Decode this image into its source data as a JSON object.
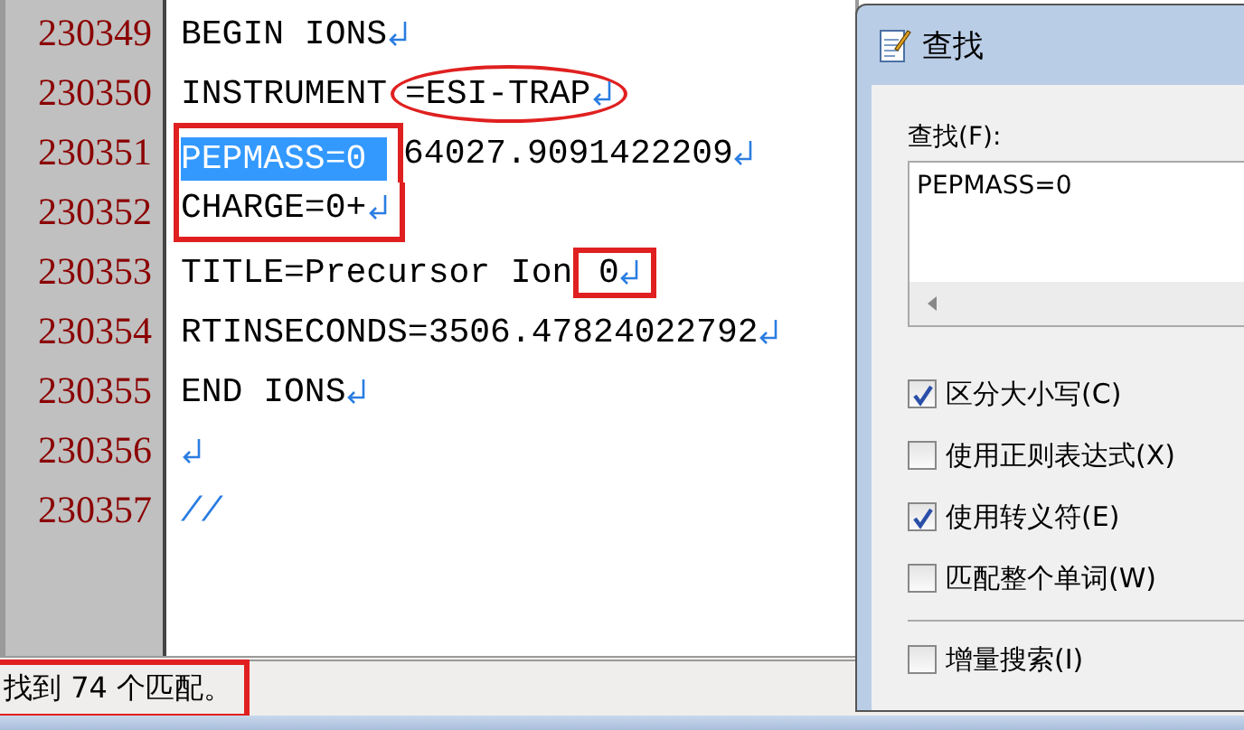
{
  "editor": {
    "lines": [
      {
        "number": "230349",
        "segments": [
          {
            "text": "BEGIN IONS"
          }
        ],
        "eol": true
      },
      {
        "number": "230350",
        "segments": [
          {
            "text": "INSTRUMENT"
          },
          {
            "text": "=ESI-TRAP",
            "circled": true,
            "eol": true
          }
        ]
      },
      {
        "number": "230351",
        "segments": [
          {
            "text": "PEPMASS=0 ",
            "selected": true,
            "boxed": true
          },
          {
            "text": "64027.9091422209"
          }
        ],
        "eol": true
      },
      {
        "number": "230352",
        "segments": [
          {
            "text": "CHARGE=0+",
            "boxed": true,
            "eol": true
          }
        ]
      },
      {
        "number": "230353",
        "segments": [
          {
            "text": "TITLE=Precursor Ion"
          },
          {
            "text": " 0",
            "boxed": true,
            "eol": true
          }
        ]
      },
      {
        "number": "230354",
        "segments": [
          {
            "text": "RTINSECONDS=3506.47824022792"
          }
        ],
        "eol": true
      },
      {
        "number": "230355",
        "segments": [
          {
            "text": "END IONS"
          }
        ],
        "eol": true
      },
      {
        "number": "230356",
        "eol": true
      },
      {
        "number": "230357",
        "segments": [
          {
            "text": "//",
            "kind": "eof"
          }
        ]
      }
    ]
  },
  "status_bar": {
    "text": "找到 74 个匹配。",
    "marked": true
  },
  "find_dialog": {
    "title": "查找",
    "find_label": "查找(F):",
    "find_value": "PEPMASS=0",
    "options": [
      {
        "label": "区分大小写(C)",
        "checked": true
      },
      {
        "label": "使用正则表达式(X)",
        "checked": false
      },
      {
        "label": "使用转义符(E)",
        "checked": true
      },
      {
        "label": "匹配整个单词(W)",
        "checked": false
      }
    ],
    "extra_options": [
      {
        "label": "增量搜索(I)",
        "checked": false
      }
    ]
  }
}
